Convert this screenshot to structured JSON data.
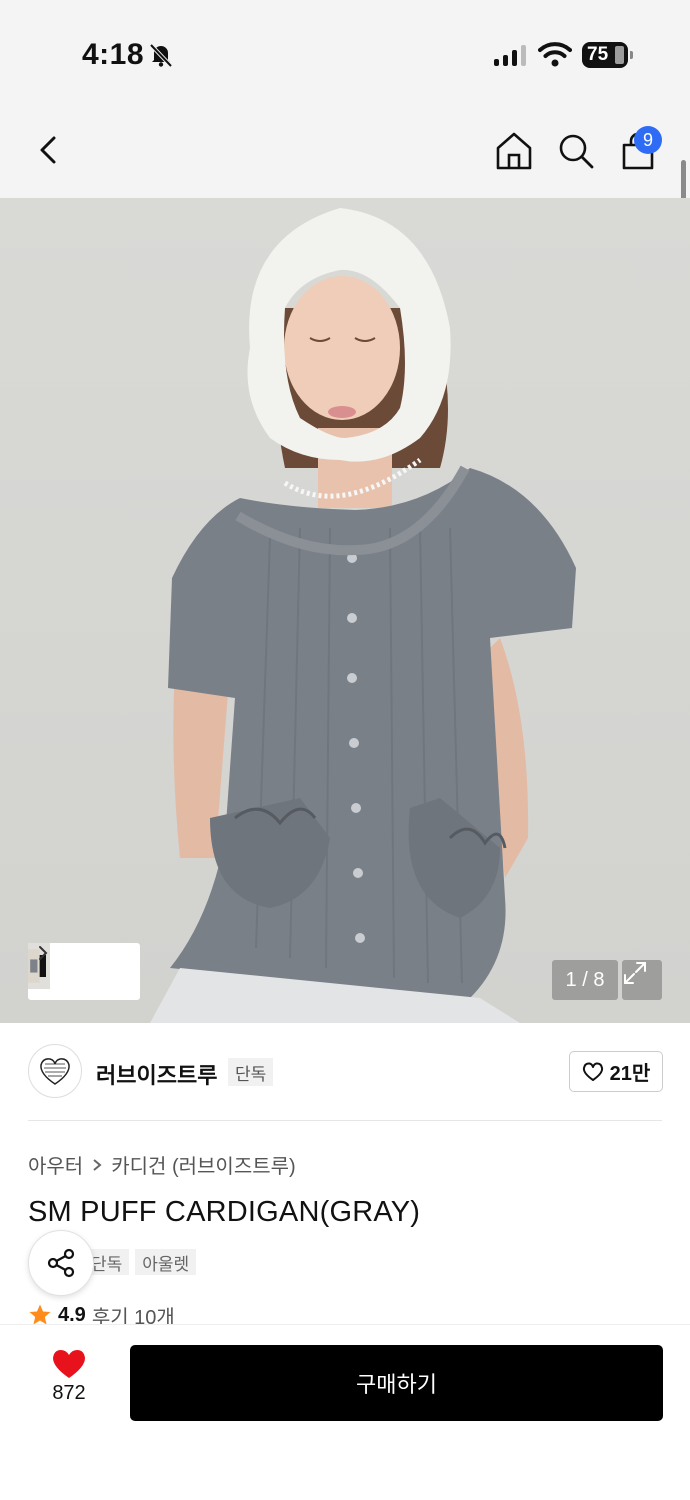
{
  "status_bar": {
    "time": "4:18",
    "battery": "75"
  },
  "header": {
    "cart_count": "9",
    "icons": [
      "back-icon",
      "home-icon",
      "search-icon",
      "shopping-bag-icon"
    ]
  },
  "gallery": {
    "counter": "1 / 8"
  },
  "brand": {
    "name": "러브이즈트루",
    "tag": "단독",
    "likes": "21만"
  },
  "breadcrumb": {
    "level1": "아우터",
    "level2": "카디건 (러브이즈트루)"
  },
  "product": {
    "title": "SM PUFF CARDIGAN(GRAY)",
    "tags": [
      "단독",
      "아울렛"
    ],
    "rating": "4.9",
    "reviews": "후기 10개"
  },
  "bottom_bar": {
    "wish_count": "872",
    "buy_label": "구매하기"
  },
  "colors": {
    "accent_blue": "#2f6cf6",
    "heart_red": "#e8121c",
    "star_orange": "#ff8c1a",
    "buy_black": "#000000"
  }
}
